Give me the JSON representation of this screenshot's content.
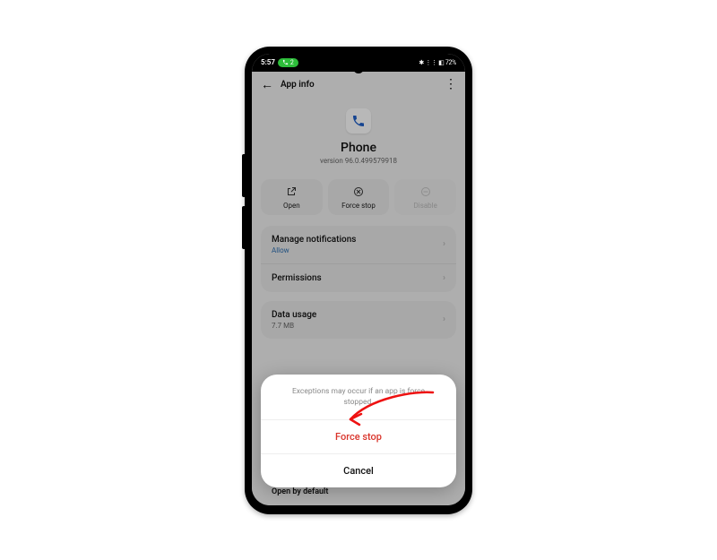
{
  "statusbar": {
    "time": "5:57",
    "pill_text": "2",
    "right_text": "✱ ⋮⋮ ◧ 72%"
  },
  "header": {
    "title": "App info"
  },
  "app": {
    "name": "Phone",
    "version": "version 96.0.499579918"
  },
  "actions": {
    "open": "Open",
    "force_stop": "Force stop",
    "disable": "Disable"
  },
  "list": {
    "manage_notifications": {
      "title": "Manage notifications",
      "sub": "Allow"
    },
    "permissions": {
      "title": "Permissions"
    },
    "data_usage": {
      "title": "Data usage",
      "sub": "7.7 MB"
    },
    "open_by_default": {
      "title": "Open by default"
    }
  },
  "dialog": {
    "message": "Exceptions may occur if an app is force stopped.",
    "confirm": "Force stop",
    "cancel": "Cancel"
  },
  "colors": {
    "danger": "#d9332a",
    "link": "#2a6fb5",
    "pill": "#2dbd3a"
  }
}
